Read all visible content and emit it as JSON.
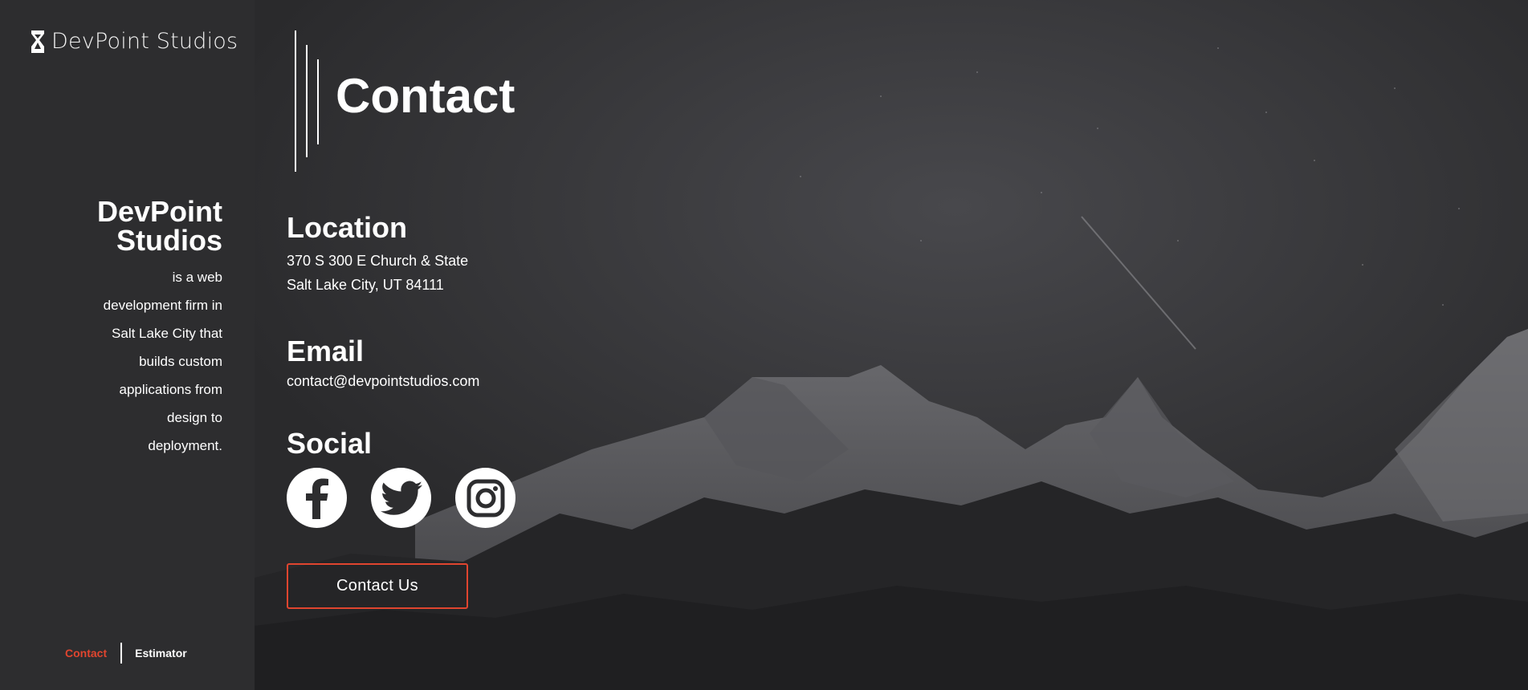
{
  "brand": {
    "name": "DevPoint Studios",
    "logo_icon": "hourglass-logo-icon"
  },
  "sidebar": {
    "about_title": "DevPoint Studios",
    "about_text": "is a web development firm in Salt Lake City that builds custom applications from design to deployment."
  },
  "footer_nav": {
    "contact_label": "Contact",
    "estimator_label": "Estimator"
  },
  "colors": {
    "accent": "#e0452f",
    "sidebar_bg": "#2d2d2f",
    "text": "#ffffff"
  },
  "page": {
    "title": "Contact"
  },
  "location": {
    "heading": "Location",
    "line1": "370 S 300 E Church & State",
    "line2": "Salt Lake City, UT 84111"
  },
  "email": {
    "heading": "Email",
    "address": "contact@devpointstudios.com"
  },
  "social": {
    "heading": "Social",
    "icons": [
      "facebook-icon",
      "twitter-icon",
      "instagram-icon"
    ]
  },
  "cta": {
    "label": "Contact Us"
  }
}
